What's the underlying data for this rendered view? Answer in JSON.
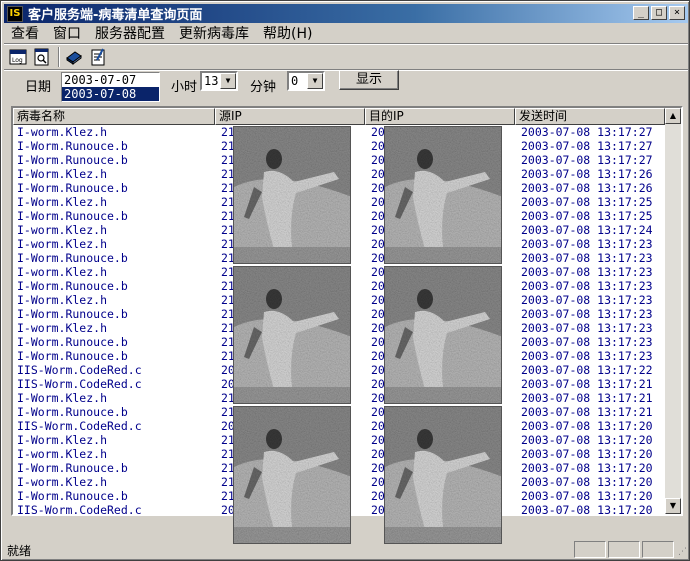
{
  "window": {
    "title": "客户服务端-病毒清单查询页面",
    "app_icon": "IS",
    "minimize": "_",
    "maximize": "□",
    "close": "×"
  },
  "menu": [
    "查看",
    "窗口",
    "服务器配置",
    "更新病毒库",
    "帮助(H)"
  ],
  "toolbar": {
    "icons": [
      "log-icon",
      "search-doc-icon",
      "book-icon",
      "notepad-icon"
    ],
    "icon_1_text": "Log"
  },
  "filters": {
    "date_label": "日期",
    "date_options": [
      "2003-07-07",
      "2003-07-08"
    ],
    "date_selected": "2003-07-08",
    "hour_label": "小时",
    "hour_value": "13",
    "minute_label": "分钟",
    "minute_value": "0",
    "show_button": "显示",
    "dropdown_arrow": "▼"
  },
  "table": {
    "columns": [
      "病毒名称",
      "源IP",
      "目的IP",
      "发送时间"
    ],
    "rows": [
      [
        "I-worm.Klez.h",
        "21",
        "20",
        "2003-07-08  13:17:27"
      ],
      [
        "I-Worm.Runouce.b",
        "21",
        "20",
        "2003-07-08  13:17:27"
      ],
      [
        "I-Worm.Runouce.b",
        "21",
        "20",
        "2003-07-08  13:17:27"
      ],
      [
        "I-Worm.Klez.h",
        "21",
        "20",
        "2003-07-08  13:17:26"
      ],
      [
        "I-Worm.Runouce.b",
        "21",
        "20",
        "2003-07-08  13:17:26"
      ],
      [
        "I-Worm.Klez.h",
        "21",
        "20",
        "2003-07-08  13:17:25"
      ],
      [
        "I-Worm.Runouce.b",
        "21",
        "20",
        "2003-07-08  13:17:25"
      ],
      [
        "I-worm.Klez.h",
        "21",
        "20",
        "2003-07-08  13:17:24"
      ],
      [
        "I-worm.Klez.h",
        "21",
        "20",
        "2003-07-08  13:17:23"
      ],
      [
        "I-Worm.Runouce.b",
        "21",
        "20",
        "2003-07-08  13:17:23"
      ],
      [
        "I-worm.Klez.h",
        "21",
        "20",
        "2003-07-08  13:17:23"
      ],
      [
        "I-Worm.Runouce.b",
        "21",
        "20",
        "2003-07-08  13:17:23"
      ],
      [
        "I-Worm.Klez.h",
        "21",
        "20",
        "2003-07-08  13:17:23"
      ],
      [
        "I-Worm.Runouce.b",
        "21",
        "20",
        "2003-07-08  13:17:23"
      ],
      [
        "I-worm.Klez.h",
        "21",
        "20",
        "2003-07-08  13:17:23"
      ],
      [
        "I-Worm.Runouce.b",
        "21",
        "20",
        "2003-07-08  13:17:23"
      ],
      [
        "I-Worm.Runouce.b",
        "21",
        "20",
        "2003-07-08  13:17:23"
      ],
      [
        "IIS-Worm.CodeRed.c",
        "20",
        "20",
        "2003-07-08  13:17:22"
      ],
      [
        "IIS-Worm.CodeRed.c",
        "20",
        "20",
        "2003-07-08  13:17:21"
      ],
      [
        "I-Worm.Klez.h",
        "21",
        "20",
        "2003-07-08  13:17:21"
      ],
      [
        "I-Worm.Runouce.b",
        "21",
        "20",
        "2003-07-08  13:17:21"
      ],
      [
        "IIS-Worm.CodeRed.c",
        "20",
        "20",
        "2003-07-08  13:17:20"
      ],
      [
        "I-Worm.Klez.h",
        "21",
        "20",
        "2003-07-08  13:17:20"
      ],
      [
        "I-worm.Klez.h",
        "21",
        "20",
        "2003-07-08  13:17:20"
      ],
      [
        "I-Worm.Runouce.b",
        "21",
        "20",
        "2003-07-08  13:17:20"
      ],
      [
        "I-worm.Klez.h",
        "21",
        "20",
        "2003-07-08  13:17:20"
      ],
      [
        "I-Worm.Runouce.b",
        "21",
        "20",
        "2003-07-08  13:17:20"
      ],
      [
        "IIS-Worm.CodeRed.c",
        "20",
        "20",
        "2003-07-08  13:17:20"
      ],
      [
        "I-worm.Klez.h",
        "21",
        "20",
        "2003-07-08  13:17:19"
      ]
    ]
  },
  "scroll": {
    "up": "▲",
    "down": "▼"
  },
  "status": {
    "text": "就绪",
    "grip": "⋰"
  }
}
